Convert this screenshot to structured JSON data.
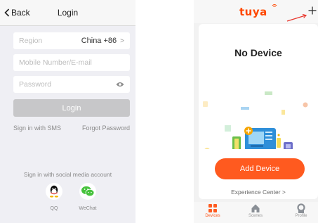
{
  "login": {
    "back_label": "Back",
    "title": "Login",
    "region": {
      "placeholder": "Region",
      "value": "China +86",
      "chevron": ">"
    },
    "phone": {
      "placeholder": "Mobile Number/E-mail"
    },
    "password": {
      "placeholder": "Password",
      "icon": "eye-icon"
    },
    "login_button": "Login",
    "sms_link": "Sign in with SMS",
    "forgot_link": "Forgot Password",
    "social_title": "Sign in with social media account",
    "social": [
      {
        "name": "qq",
        "label": "QQ",
        "icon": "qq-icon"
      },
      {
        "name": "wechat",
        "label": "WeChat",
        "icon": "wechat-icon"
      }
    ]
  },
  "home": {
    "logo": "tuya",
    "no_device": "No Device",
    "add_device": "Add Device",
    "experience_center": "Experience Center >",
    "tabs": [
      {
        "label": "Devices",
        "icon": "devices-icon",
        "active": true
      },
      {
        "label": "Scenes",
        "icon": "home-icon",
        "active": false
      },
      {
        "label": "Profile",
        "icon": "profile-icon",
        "active": false
      }
    ]
  },
  "colors": {
    "accent": "#ff5a1f",
    "logo": "#ff4800",
    "button_disabled": "#c7c7c9"
  }
}
